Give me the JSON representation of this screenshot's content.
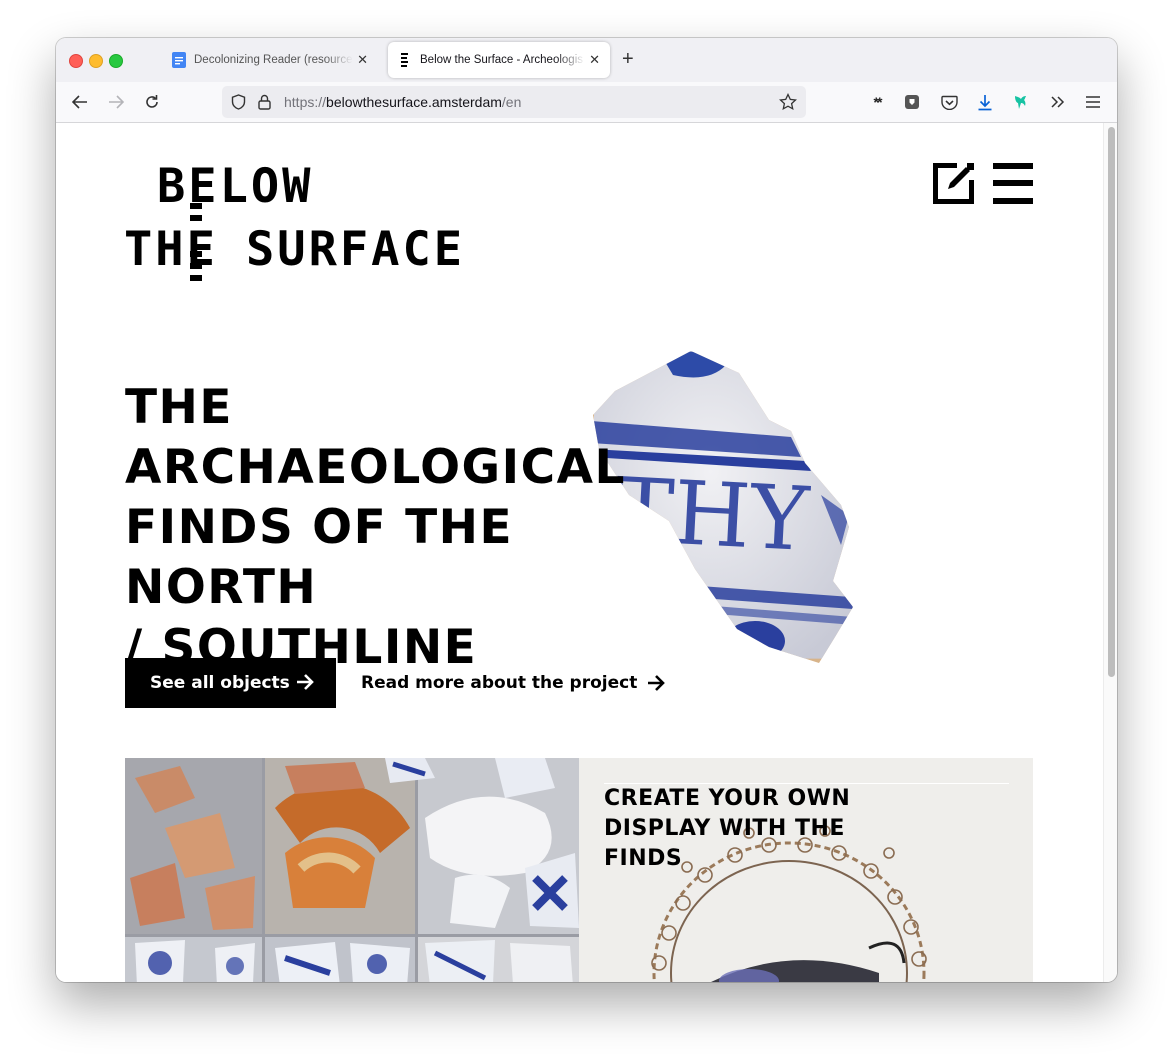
{
  "browser": {
    "tabs": [
      {
        "title": "Decolonizing Reader (resources",
        "active": false
      },
      {
        "title": "Below the Surface - Archeologis",
        "active": true
      }
    ],
    "url_prefix": "https://",
    "url_host": "belowthesurface.amsterdam",
    "url_path": "/en"
  },
  "site": {
    "logo_line1": "BELOW",
    "logo_line2a": "THE",
    "logo_line2b": "SURFACE",
    "header_icons": [
      "edit-icon",
      "menu-icon"
    ]
  },
  "hero": {
    "title_lines": [
      "THE",
      "ARCHAEOLOGICAL",
      "FINDS OF THE NORTH",
      "/ SOUTHLINE"
    ],
    "primary_button": "See all objects",
    "secondary_link": "Read more about the project"
  },
  "cards": {
    "display_title": "CREATE YOUR OWN DISPLAY WITH THE FINDS"
  },
  "colors": {
    "accent": "#000000",
    "delft_blue": "#2a3f9e",
    "card_bg": "#efeeeb"
  }
}
